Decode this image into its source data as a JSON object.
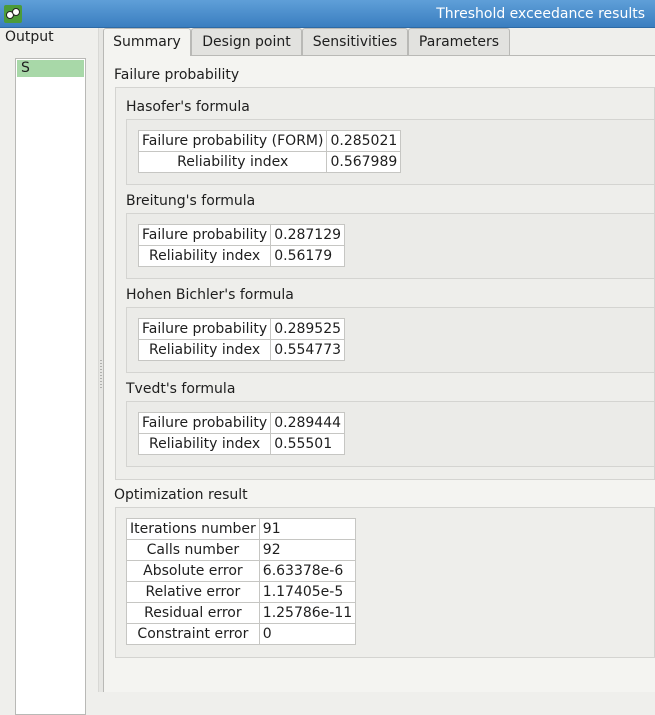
{
  "window": {
    "title": "Threshold exceedance results"
  },
  "left_panel": {
    "label": "Output",
    "items": [
      "S"
    ]
  },
  "tabs": [
    "Summary",
    "Design point",
    "Sensitivities",
    "Parameters"
  ],
  "failure_probability": {
    "title": "Failure probability",
    "hasofer": {
      "title": "Hasofer's formula",
      "rows": [
        [
          "Failure probability (FORM)",
          "0.285021"
        ],
        [
          "Reliability index",
          "0.567989"
        ]
      ]
    },
    "breitung": {
      "title": "Breitung's formula",
      "rows": [
        [
          "Failure probability",
          "0.287129"
        ],
        [
          "Reliability index",
          "0.56179"
        ]
      ]
    },
    "hohen_bichler": {
      "title": "Hohen Bichler's formula",
      "rows": [
        [
          "Failure probability",
          "0.289525"
        ],
        [
          "Reliability index",
          "0.554773"
        ]
      ]
    },
    "tvedt": {
      "title": "Tvedt's formula",
      "rows": [
        [
          "Failure probability",
          "0.289444"
        ],
        [
          "Reliability index",
          "0.55501"
        ]
      ]
    }
  },
  "optimization": {
    "title": "Optimization result",
    "rows": [
      [
        "Iterations number",
        "91"
      ],
      [
        "Calls number",
        "92"
      ],
      [
        "Absolute error",
        "6.63378e-6"
      ],
      [
        "Relative error",
        "1.17405e-5"
      ],
      [
        "Residual error",
        "1.25786e-11"
      ],
      [
        "Constraint error",
        "0"
      ]
    ]
  }
}
